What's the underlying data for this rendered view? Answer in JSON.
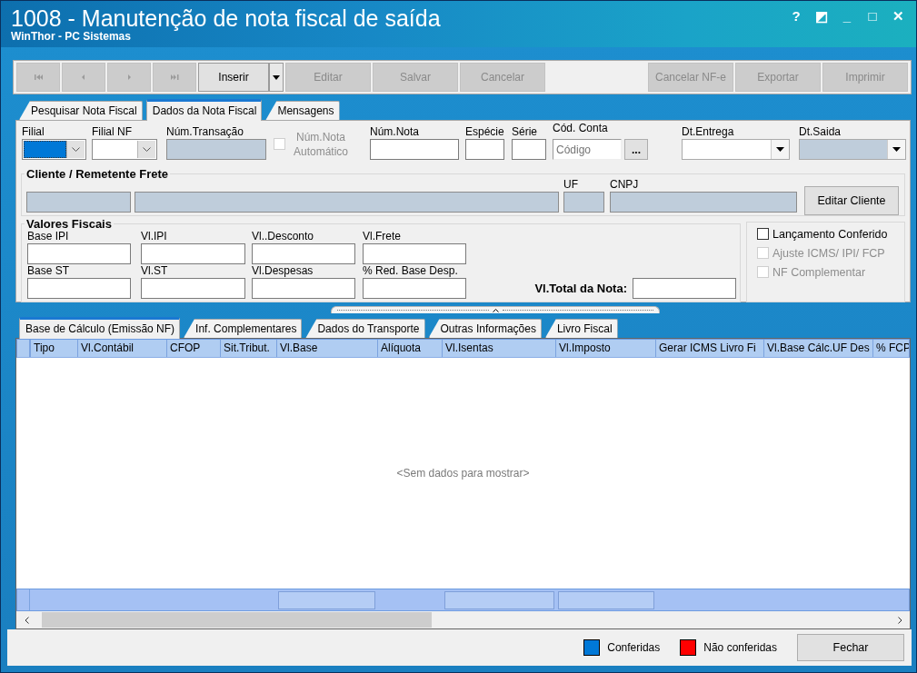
{
  "window": {
    "title": "1008 - Manutenção de nota fiscal de saída",
    "subtitle": "WinThor - PC Sistemas",
    "controls": [
      "?",
      "◩",
      "_",
      "□",
      "✕"
    ]
  },
  "toolbar": {
    "nav_buttons": [
      {
        "disabled": true
      },
      {
        "disabled": true
      },
      {
        "disabled": true
      },
      {
        "disabled": true
      }
    ],
    "buttons": [
      {
        "label": "Inserir",
        "kind": "split",
        "disabled": false
      },
      {
        "label": "Editar",
        "kind": "plain",
        "disabled": true
      },
      {
        "label": "Salvar",
        "kind": "plain",
        "disabled": true
      },
      {
        "label": "Cancelar",
        "kind": "plain",
        "disabled": true
      }
    ],
    "right_buttons": [
      {
        "label": "Cancelar NF-e",
        "kind": "plain",
        "disabled": true
      },
      {
        "label": "Exportar",
        "kind": "plain",
        "disabled": true
      },
      {
        "label": "Imprimir",
        "kind": "plain",
        "disabled": true
      }
    ]
  },
  "tabs": [
    {
      "label": "Pesquisar Nota Fiscal",
      "selected": false
    },
    {
      "label": "Dados da Nota Fiscal",
      "selected": true
    },
    {
      "label": "Mensagens",
      "selected": false
    }
  ],
  "header_fields": [
    {
      "kind": "combo",
      "label": "Filial",
      "focused": true
    },
    {
      "kind": "combo",
      "label": "Filial NF",
      "focused": false
    },
    {
      "kind": "text",
      "label": "Núm.Transação",
      "readonly": true
    },
    {
      "kind": "check",
      "label": "Núm.Nota Automático",
      "checked": false,
      "disabled": true
    },
    {
      "kind": "text",
      "label": "Núm.Nota",
      "readonly": false
    },
    {
      "kind": "text",
      "label": "Espécie",
      "readonly": false
    },
    {
      "kind": "text",
      "label": "Série",
      "readonly": false
    },
    {
      "kind": "lookup",
      "label": "Cód. Conta",
      "placeholder": "Código",
      "button_label": "..."
    },
    {
      "kind": "date",
      "label": "Dt.Entrega",
      "readonly": false
    },
    {
      "kind": "date",
      "label": "Dt.Saida",
      "readonly": true
    }
  ],
  "client": {
    "title": "Cliente / Remetente Frete",
    "fields": [
      {
        "readonly": true
      },
      {
        "readonly": true
      },
      {
        "label": "UF",
        "readonly": true
      },
      {
        "label": "CNPJ",
        "readonly": true
      }
    ],
    "button": "Editar Cliente"
  },
  "fiscal_values": {
    "title": "Valores Fiscais",
    "fields": [
      {
        "label": "Base IPI"
      },
      {
        "label": "Vl.IPI"
      },
      {
        "label": "Vl..Desconto"
      },
      {
        "label": "Vl.Frete"
      },
      {
        "label": "Base ST"
      },
      {
        "label": "Vl.ST"
      },
      {
        "label": "Vl.Despesas"
      },
      {
        "label": "% Red. Base Desp."
      }
    ],
    "total_label": "Vl.Total da Nota:"
  },
  "options": [
    {
      "label": "Lançamento Conferido",
      "checked": false,
      "disabled": false
    },
    {
      "label": "Ajuste ICMS/ IPI/ FCP",
      "checked": false,
      "disabled": true
    },
    {
      "label": "NF Complementar",
      "checked": false,
      "disabled": true
    }
  ],
  "detail_tabs": [
    {
      "label": "Base de Cálculo (Emissão NF)",
      "selected": true
    },
    {
      "label": "Inf. Complementares",
      "selected": false
    },
    {
      "label": "Dados do Transporte",
      "selected": false
    },
    {
      "label": "Outras Informações",
      "selected": false
    },
    {
      "label": "Livro Fiscal",
      "selected": false
    }
  ],
  "grid": {
    "columns": [
      "Tipo",
      "Vl.Contábil",
      "CFOP",
      "Sit.Tribut.",
      "Vl.Base",
      "Alíquota",
      "Vl.Isentas",
      "Vl.Imposto",
      "Gerar ICMS Livro Fi",
      "Vl.Base Cálc.UF Des",
      "% FCP"
    ],
    "empty_message": "<Sem dados para mostrar>"
  },
  "legend": [
    {
      "label": "Conferidas",
      "color": "#0078d7"
    },
    {
      "label": "Não conferidas",
      "color": "#ff0000"
    }
  ],
  "close_button": "Fechar"
}
